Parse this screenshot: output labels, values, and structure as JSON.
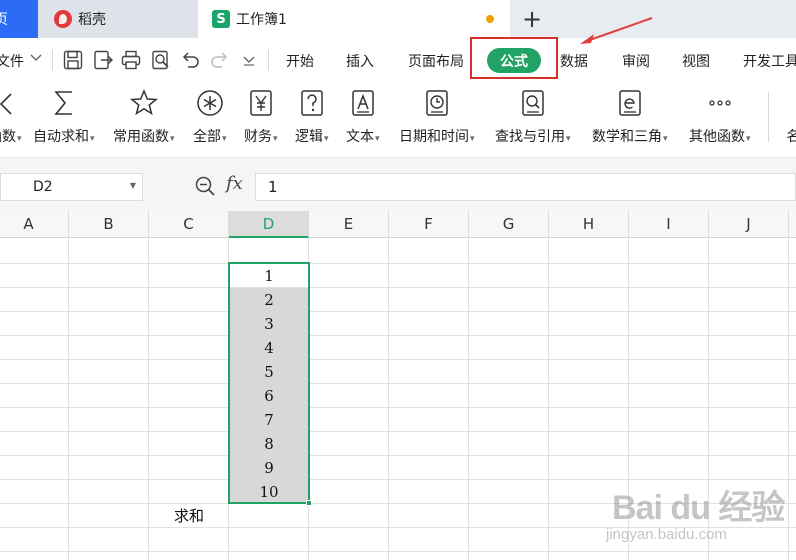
{
  "tabs": [
    {
      "label": "页"
    },
    {
      "label": "稻壳"
    },
    {
      "label": "工作簿1",
      "icon_text": "S"
    },
    {
      "label": "+"
    }
  ],
  "menu": {
    "file": "文件",
    "items": [
      "开始",
      "插入",
      "页面布局",
      "公式",
      "数据",
      "审阅",
      "视图",
      "开发工具"
    ],
    "active": "公式"
  },
  "ribbon": [
    {
      "label": "函数",
      "icon": "insert-function-icon"
    },
    {
      "label": "自动求和",
      "icon": "sigma-icon"
    },
    {
      "label": "常用函数",
      "icon": "star-icon"
    },
    {
      "label": "全部",
      "icon": "asterisk-circle-icon"
    },
    {
      "label": "财务",
      "icon": "yen-icon"
    },
    {
      "label": "逻辑",
      "icon": "question-icon"
    },
    {
      "label": "文本",
      "icon": "text-a-icon"
    },
    {
      "label": "日期和时间",
      "icon": "clock-icon"
    },
    {
      "label": "查找与引用",
      "icon": "magnifier-icon"
    },
    {
      "label": "数学和三角",
      "icon": "math-e-icon"
    },
    {
      "label": "其他函数",
      "icon": "more-icon"
    },
    {
      "label": "名",
      "icon": "name-icon"
    }
  ],
  "formula_bar": {
    "name_box": "D2",
    "fx_label": "fx",
    "value": "1"
  },
  "grid": {
    "columns": [
      "A",
      "B",
      "C",
      "D",
      "E",
      "F",
      "G",
      "H",
      "I",
      "J"
    ],
    "selected_column": "D",
    "column_d_values": [
      "1",
      "2",
      "3",
      "4",
      "5",
      "6",
      "7",
      "8",
      "9",
      "10"
    ],
    "sum_label": "求和"
  },
  "colors": {
    "accent_green": "#21a366",
    "highlight_red": "#d9302c",
    "selection_fill": "#d8d8d8"
  },
  "watermark": {
    "title": "Bai du 经验",
    "subtitle": "jingyan.baidu.com"
  }
}
